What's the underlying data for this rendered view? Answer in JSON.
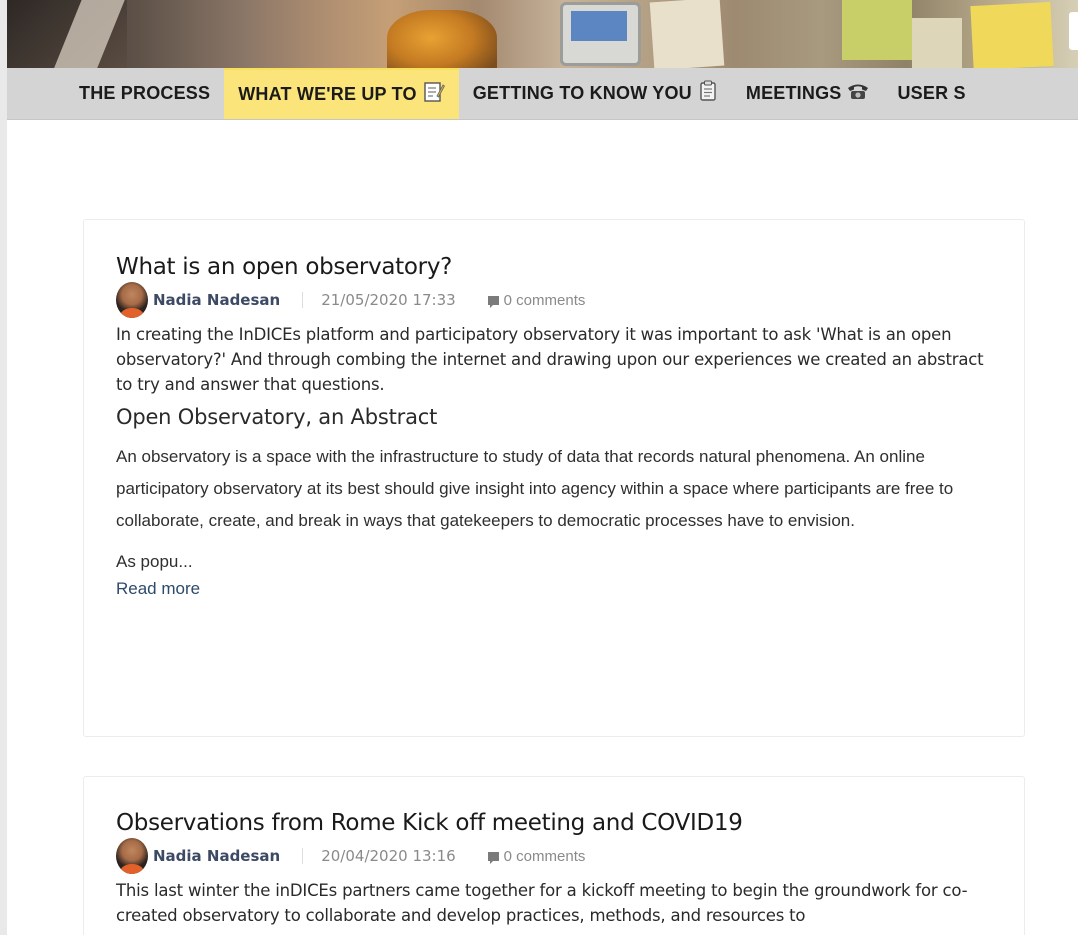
{
  "nav": {
    "items": [
      {
        "label": "THE PROCESS",
        "icon": "",
        "active": false
      },
      {
        "label": "WHAT WE'RE UP TO",
        "icon": "notepad-icon",
        "active": true
      },
      {
        "label": "GETTING TO KNOW YOU",
        "icon": "clipboard-icon",
        "active": false
      },
      {
        "label": "MEETINGS",
        "icon": "telephone-icon",
        "active": false
      },
      {
        "label": "USER S",
        "icon": "",
        "active": false
      }
    ]
  },
  "posts": [
    {
      "title": "What is an open observatory?",
      "author": "Nadia Nadesan",
      "date": "21/05/2020 17:33",
      "comments": "0 comments",
      "excerpt": "In creating the InDICEs platform and participatory observatory it was important to ask 'What is an open observatory?' And through combing the internet and drawing upon our experiences we created an abstract to try and answer that questions.",
      "subheading": "Open Observatory, an Abstract",
      "paragraph": "An observatory is a space with the infrastructure to study of data that records natural phenomena. An online participatory observatory at its best should give insight into agency within a space where participants are free to collaborate, create, and break in ways that gatekeepers to democratic processes have to envision.",
      "truncated": "As popu...",
      "read_more": "Read more"
    },
    {
      "title": "Observations from Rome Kick off meeting and COVID19",
      "author": "Nadia Nadesan",
      "date": "20/04/2020 13:16",
      "comments": "0 comments",
      "excerpt": "This last winter the inDICEs partners came together for a kickoff meeting to begin the groundwork for co-created observatory to collaborate and develop practices, methods, and resources to"
    }
  ],
  "colors": {
    "nav_bg": "#d4d4d4",
    "nav_active": "#fbe57a",
    "author": "#3c4a64",
    "link": "#2d4a6b"
  }
}
